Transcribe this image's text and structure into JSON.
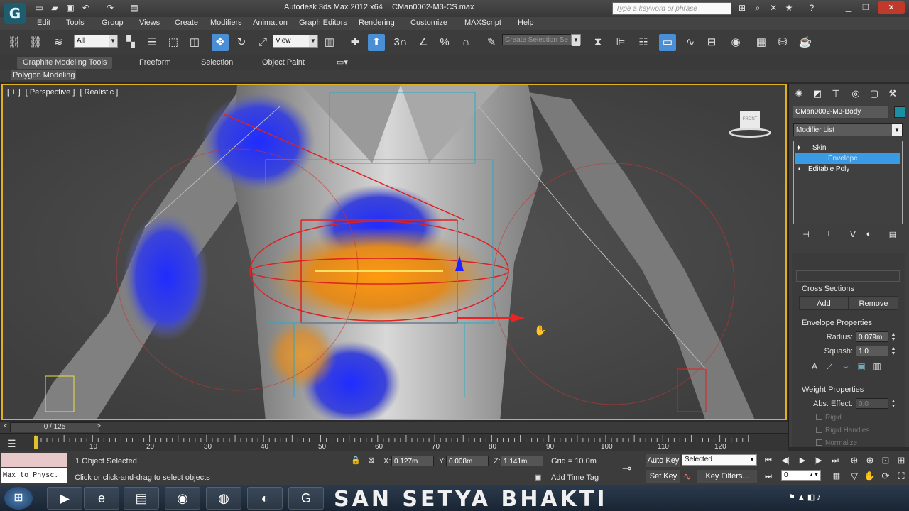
{
  "app": {
    "title": "Autodesk 3ds Max 2012 x64",
    "file": "CMan0002-M3-CS.max",
    "search_placeholder": "Type a keyword or phrase"
  },
  "menu": [
    "Edit",
    "Tools",
    "Group",
    "Views",
    "Create",
    "Modifiers",
    "Animation",
    "Graph Editors",
    "Rendering",
    "Customize",
    "MAXScript",
    "Help"
  ],
  "toolbar": {
    "selection_filter": "All",
    "ref_coord": "View",
    "selection_set_placeholder": "Create Selection Se",
    "snap_labels": {
      "snap": "3",
      "angle": "",
      "percent": "%",
      "spinner": ""
    }
  },
  "ribbon": {
    "tabs": [
      "Graphite Modeling Tools",
      "Freeform",
      "Selection",
      "Object Paint"
    ],
    "sub_panel": "Polygon Modeling"
  },
  "viewport": {
    "labels": [
      "[ + ]",
      "[ Perspective ]",
      "[ Realistic ]"
    ],
    "viewcube_label": "FRONT"
  },
  "command_panel": {
    "object_name": "CMan0002-M3-Body",
    "object_color": "#1a8ea5",
    "modifier_list": "Modifier List",
    "stack": [
      "Skin",
      "Envelope",
      "Editable Poly"
    ],
    "cross_sections": {
      "title": "Cross Sections",
      "add": "Add",
      "remove": "Remove"
    },
    "envelope_props": {
      "title": "Envelope Properties",
      "radius_label": "Radius:",
      "radius_value": "0.079m",
      "squash_label": "Squash:",
      "squash_value": "1.0"
    },
    "weight_props": {
      "title": "Weight Properties",
      "abs_label": "Abs. Effect:",
      "abs_value": "0.0",
      "rigid": "Rigid",
      "rigid_handles": "Rigid Handles",
      "normalize": "Normalize"
    }
  },
  "timeline": {
    "frame_display": "0 / 125",
    "ticks": [
      "10",
      "20",
      "30",
      "40",
      "50",
      "60",
      "70",
      "80",
      "90",
      "100",
      "110",
      "120"
    ]
  },
  "status": {
    "maxscript_text": "Max to Physc.",
    "selected_count": "1 Object Selected",
    "prompt": "Click or click-and-drag to select objects",
    "x_label": "X:",
    "x_value": "0.127m",
    "y_label": "Y:",
    "y_value": "0.008m",
    "z_label": "Z:",
    "z_value": "1.141m",
    "grid": "Grid = 10.0m",
    "add_time_tag": "Add Time Tag",
    "auto_key": "Auto Key",
    "set_key": "Set Key",
    "key_mode": "Selected",
    "key_filters": "Key Filters...",
    "current_frame": "0"
  },
  "taskbar": {
    "banner_text": "SAN SETYA BHAKTI"
  }
}
